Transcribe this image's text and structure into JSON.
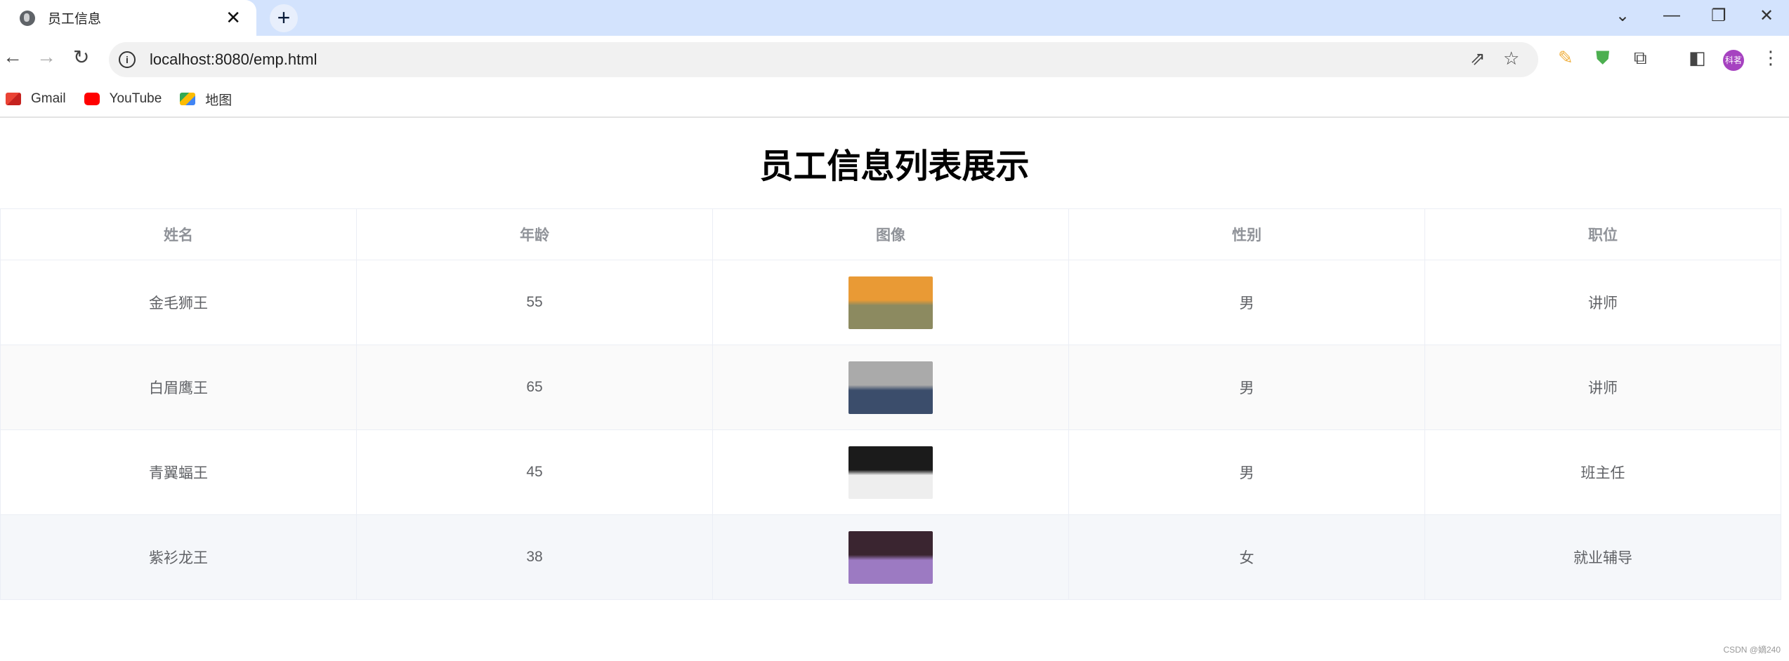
{
  "browser": {
    "tab_title": "员工信息",
    "url": "localhost:8080/emp.html",
    "profile_initials": "科茗",
    "bookmarks": [
      {
        "label": "Gmail",
        "icon": "gmail-icon"
      },
      {
        "label": "YouTube",
        "icon": "youtube-icon"
      },
      {
        "label": "地图",
        "icon": "maps-icon"
      }
    ]
  },
  "page": {
    "title": "员工信息列表展示",
    "columns": [
      "姓名",
      "年龄",
      "图像",
      "性别",
      "职位"
    ],
    "rows": [
      {
        "name": "金毛狮王",
        "age": "55",
        "gender": "男",
        "job": "讲师",
        "image_colors": [
          "#e99a35",
          "#8c8a60"
        ]
      },
      {
        "name": "白眉鹰王",
        "age": "65",
        "gender": "男",
        "job": "讲师",
        "image_colors": [
          "#aaaaaa",
          "#3b4d6b"
        ]
      },
      {
        "name": "青翼蝠王",
        "age": "45",
        "gender": "男",
        "job": "班主任",
        "image_colors": [
          "#1b1b1b",
          "#eeeeee"
        ]
      },
      {
        "name": "紫衫龙王",
        "age": "38",
        "gender": "女",
        "job": "就业辅导",
        "image_colors": [
          "#3a2530",
          "#9c7ac2"
        ]
      }
    ]
  },
  "watermark": "CSDN @嫡240"
}
